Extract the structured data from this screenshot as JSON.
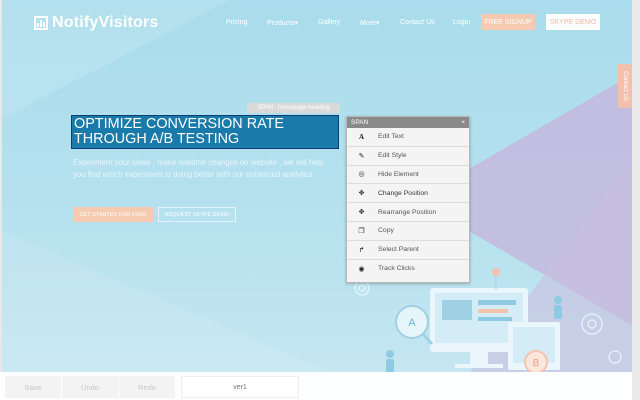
{
  "nav": {
    "logo": "NotifyVisitors",
    "links": [
      "Pricing",
      "Products▾",
      "Gallery",
      "More▾",
      "Contact Us",
      "Login"
    ],
    "signup": "FREE SIGNUP",
    "demo": "SKYPE DEMO"
  },
  "contact_tab": "Contact Us",
  "hero": {
    "element_tag": "SPAN . homepage-heading",
    "headline": "OPTIMIZE CONVERSION RATE THROUGH A/B TESTING",
    "subtext": "Experiment your ideas , make realtime changes on website , we will help you find which experiment is doing better with our enhanced analytics",
    "cta_primary": "GET STARTED FOR FREE",
    "cta_secondary": "REQUEST SKYPE DEMO"
  },
  "context_menu": {
    "title": "SPAN",
    "close": "×",
    "items": [
      {
        "label": "Edit Text",
        "icon": "text-a-icon",
        "glyph": "A"
      },
      {
        "label": "Edit Style",
        "icon": "brush-icon",
        "glyph": "✎"
      },
      {
        "label": "Hide Element",
        "icon": "eye-slash-icon",
        "glyph": "◎"
      },
      {
        "label": "Change Position",
        "icon": "move-icon",
        "glyph": "✥"
      },
      {
        "label": "Rearrange Position",
        "icon": "arrange-icon",
        "glyph": "✥"
      },
      {
        "label": "Copy",
        "icon": "copy-icon",
        "glyph": "❐"
      },
      {
        "label": "Select Parent",
        "icon": "parent-arrow-icon",
        "glyph": "↱"
      },
      {
        "label": "Track Clicks",
        "icon": "target-icon",
        "glyph": "◉"
      }
    ]
  },
  "bottom_bar": {
    "save": "Save",
    "undo": "Undo",
    "redo": "Redo",
    "variation": "ver1"
  },
  "colors": {
    "hero_bg": "#b3e0ee",
    "accent": "#f6c9b1",
    "selection": "#1a7aaa",
    "purple_shape": "#c4b9de"
  }
}
